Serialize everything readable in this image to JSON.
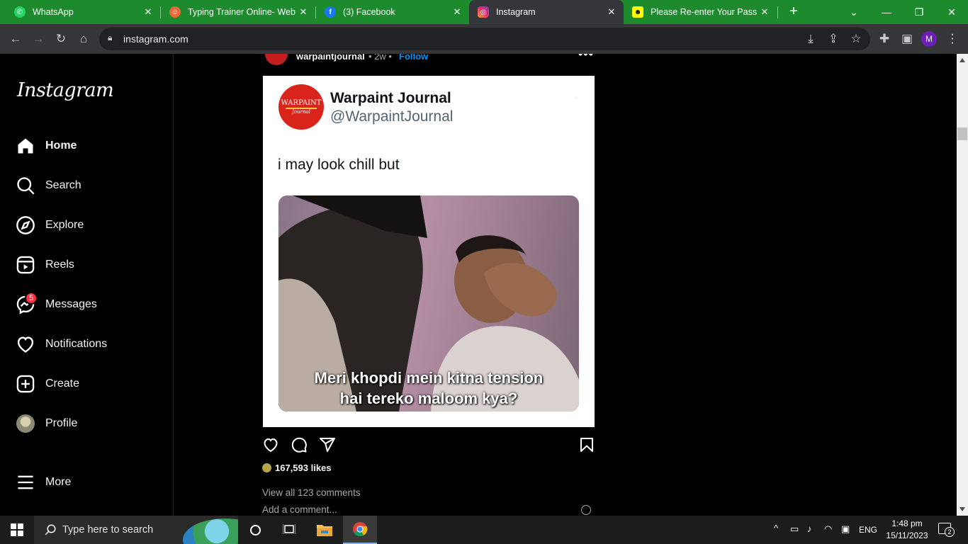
{
  "browser": {
    "tabs": [
      {
        "label": "WhatsApp",
        "icon": "whatsapp-icon",
        "active": false
      },
      {
        "label": "Typing Trainer Online- Web",
        "icon": "typing-trainer-icon",
        "active": false
      },
      {
        "label": "(3) Facebook",
        "icon": "facebook-icon",
        "active": false
      },
      {
        "label": "Instagram",
        "icon": "instagram-icon",
        "active": true
      },
      {
        "label": "Please Re-enter Your Passwo",
        "icon": "snapchat-icon",
        "active": false
      }
    ],
    "url": "instagram.com",
    "profile_initial": "M",
    "tabstrip_color": "#1d8a2e"
  },
  "instagram": {
    "logo": "Instagram",
    "nav": [
      {
        "label": "Home",
        "icon": "home-icon",
        "active": true
      },
      {
        "label": "Search",
        "icon": "search-icon"
      },
      {
        "label": "Explore",
        "icon": "explore-icon"
      },
      {
        "label": "Reels",
        "icon": "reels-icon"
      },
      {
        "label": "Messages",
        "icon": "messenger-icon",
        "badge": "5"
      },
      {
        "label": "Notifications",
        "icon": "heart-icon"
      },
      {
        "label": "Create",
        "icon": "create-icon"
      },
      {
        "label": "Profile",
        "icon": "profile-avatar"
      },
      {
        "label": "More",
        "icon": "menu-icon"
      }
    ],
    "post": {
      "username": "warpaintjournal",
      "time": "• 2w •",
      "follow": "Follow",
      "more": "•••",
      "card": {
        "avatar_text": "WARPAINT",
        "avatar_subtext": "Journal",
        "name": "Warpaint Journal",
        "handle": "@WarpaintJournal",
        "text": "i may look chill but",
        "meme_caption_line1": "Meri khopdi mein kitna tension",
        "meme_caption_line2": "hai tereko maloom kya?"
      },
      "likes": "167,593 likes",
      "view_comments": "View all 123 comments",
      "add_comment_placeholder": "Add a comment..."
    }
  },
  "taskbar": {
    "search_placeholder": "Type here to search",
    "language": "ENG",
    "time": "1:48 pm",
    "date": "15/11/2023",
    "notification_count": "2"
  }
}
